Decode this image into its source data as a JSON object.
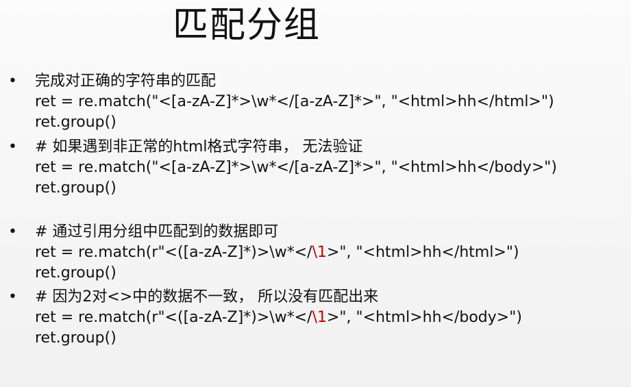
{
  "title": "匹配分组",
  "bullets": [
    {
      "bullet": "•",
      "heading": "完成对正确的字符串的匹配",
      "code": "ret = re.match(\"<[a-zA-Z]*>\\w*</[a-zA-Z]*>\", \"<html>hh</html>\")",
      "call": "ret.group()"
    },
    {
      "bullet": "•",
      "heading": "# 如果遇到非正常的html格式字符串， 无法验证",
      "code": "ret = re.match(\"<[a-zA-Z]*>\\w*</[a-zA-Z]*>\", \"<html>hh</body>\")",
      "call": "ret.group()"
    },
    {
      "bullet": "•",
      "heading": "# 通过引用分组中匹配到的数据即可",
      "code_prefix": "ret = re.match(r\"<([a-zA-Z]*)>\\w*</",
      "code_ref": "\\1",
      "code_suffix": ">\", \"<html>hh</html>\")",
      "call": "ret.group()"
    },
    {
      "bullet": "•",
      "heading": "# 因为2对<>中的数据不一致， 所以没有匹配出来",
      "code_prefix": "ret = re.match(r\"<([a-zA-Z]*)>\\w*</",
      "code_ref": "\\1",
      "code_suffix": ">\", \"<html>hh</body>\")",
      "call": "ret.group()"
    }
  ],
  "colors": {
    "text": "#111111",
    "backreference": "#c00000",
    "background": "#f6f6f6"
  }
}
